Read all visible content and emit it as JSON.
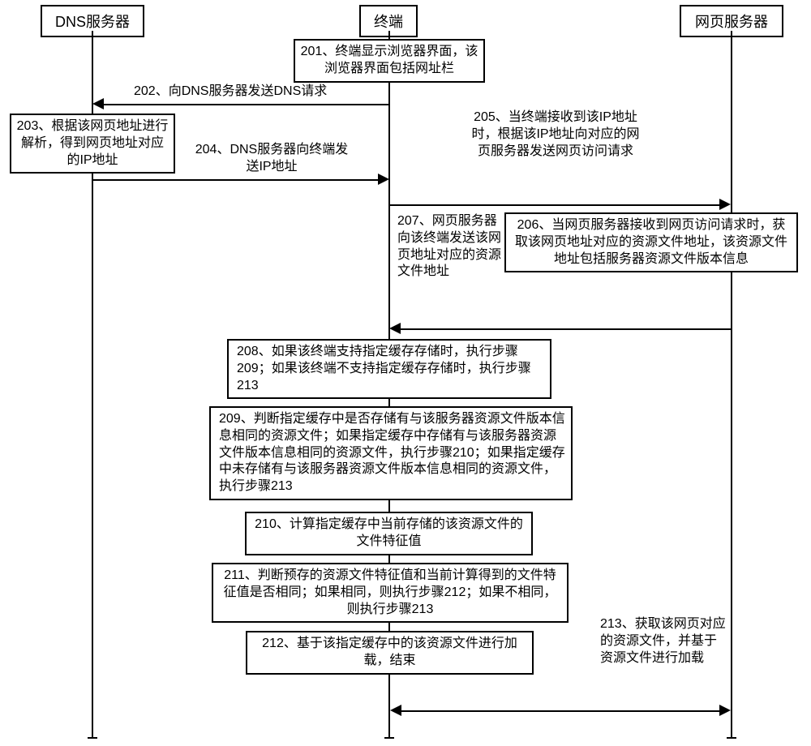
{
  "actors": {
    "dns": "DNS服务器",
    "terminal": "终端",
    "web": "网页服务器"
  },
  "steps": {
    "s201": "201、终端显示浏览器界面，该浏览器界面包括网址栏",
    "s202": "202、向DNS服务器发送DNS请求",
    "s203": "203、根据该网页地址进行解析，得到网页地址对应的IP地址",
    "s204": "204、DNS服务器向终端发送IP地址",
    "s205": "205、当终端接收到该IP地址时，根据该IP地址向对应的网页服务器发送网页访问请求",
    "s206": "206、当网页服务器接收到网页访问请求时，获取该网页地址对应的资源文件地址，该资源文件地址包括服务器资源文件版本信息",
    "s207": "207、网页服务器向该终端发送该网页地址对应的资源文件地址",
    "s208": "208、如果该终端支持指定缓存存储时，执行步骤209；如果该终端不支持指定缓存存储时，执行步骤213",
    "s209": "209、判断指定缓存中是否存储有与该服务器资源文件版本信息相同的资源文件；如果指定缓存中存储有与该服务器资源文件版本信息相同的资源文件，执行步骤210；如果指定缓存中未存储有与该服务器资源文件版本信息相同的资源文件，执行步骤213",
    "s210": "210、计算指定缓存中当前存储的该资源文件的文件特征值",
    "s211": "211、判断预存的资源文件特征值和当前计算得到的文件特征值是否相同；如果相同，则执行步骤212；如果不相同，则执行步骤213",
    "s212": "212、基于该指定缓存中的该资源文件进行加载，结束",
    "s213": "213、获取该网页对应的资源文件，并基于资源文件进行加载"
  }
}
